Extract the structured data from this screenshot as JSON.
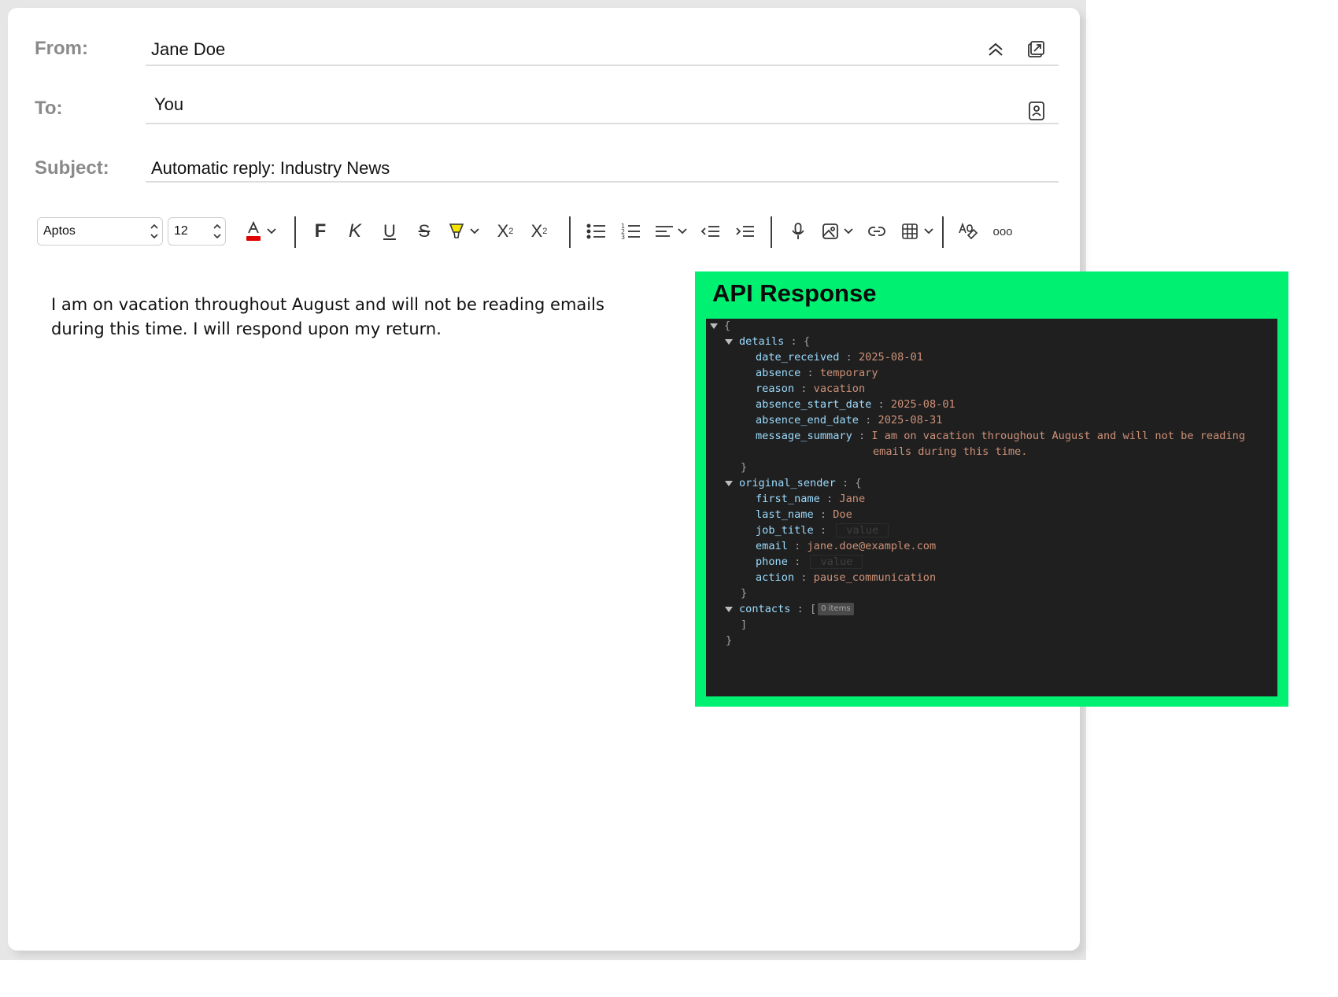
{
  "header": {
    "from_label": "From:",
    "from_value": "Jane Doe",
    "to_label": "To:",
    "to_value": "You",
    "subject_label": "Subject:",
    "subject_value": "Automatic reply: Industry News"
  },
  "toolbar": {
    "font_family": "Aptos",
    "font_size": "12",
    "font_color_swatch": "#e00000",
    "highlight_swatch": "#f3e500",
    "bold_glyph": "F",
    "italic_glyph": "K",
    "underline_glyph": "U",
    "strike_glyph": "S",
    "superscript_glyph": "X",
    "superscript_sup": "2",
    "subscript_glyph": "X",
    "subscript_sub": "2",
    "more_glyph": "ooo",
    "icons": [
      "font-color",
      "highlight",
      "bullet-list",
      "numbered-list",
      "align",
      "outdent",
      "indent",
      "dictate",
      "picture",
      "link",
      "table",
      "editor",
      "more"
    ]
  },
  "message": {
    "line1": "I am on vacation throughout August and will not be reading emails",
    "line2": "during this time. I will respond upon my return."
  },
  "api": {
    "title": "API Response",
    "open_brace": "{",
    "close_brace": "}",
    "colon": ":",
    "details_key": "details",
    "details_open": "{",
    "details_close": "}",
    "date_received_key": "date_received",
    "date_received_val": "2025-08-01",
    "absence_key": "absence",
    "absence_val": "temporary",
    "reason_key": "reason",
    "reason_val": "vacation",
    "absence_start_date_key": "absence_start_date",
    "absence_start_date_val": "2025-08-01",
    "absence_end_date_key": "absence_end_date",
    "absence_end_date_val": "2025-08-31",
    "message_summary_key": "message_summary",
    "message_summary_val1": "I am on vacation throughout August and will not be reading",
    "message_summary_val2": "emails during this time.",
    "original_sender_key": "original_sender",
    "original_sender_open": "{",
    "original_sender_close": "}",
    "first_name_key": "first_name",
    "first_name_val": "Jane",
    "last_name_key": "last_name",
    "last_name_val": "Doe",
    "job_title_key": "job_title",
    "job_title_placeholder": "value",
    "email_key": "email",
    "email_val": "jane.doe@example.com",
    "phone_key": "phone",
    "phone_placeholder": "value",
    "action_key": "action",
    "action_val": "pause_communication",
    "contacts_key": "contacts",
    "contacts_open": "[",
    "contacts_badge": "0 items",
    "contacts_close": "]"
  },
  "colors": {
    "panel_green": "#00f071",
    "json_bg": "#1f1f1f",
    "json_key": "#9cdcfe",
    "json_value": "#ce9178"
  }
}
